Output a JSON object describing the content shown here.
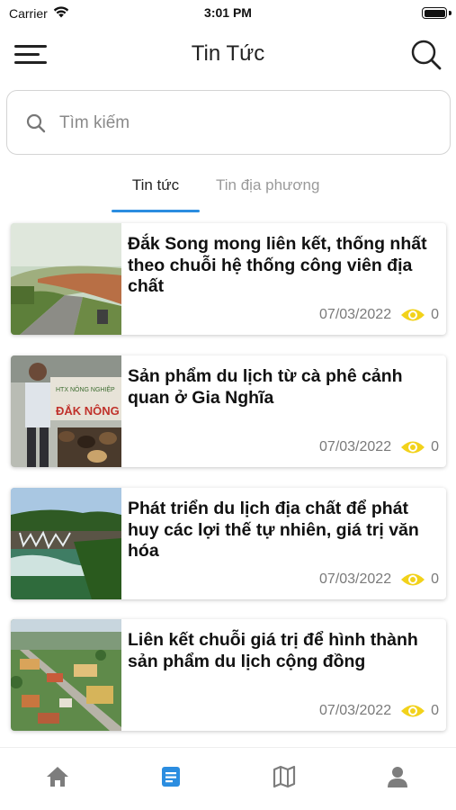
{
  "status_bar": {
    "carrier": "Carrier",
    "time": "3:01 PM",
    "icons": [
      "wifi-icon",
      "battery-icon"
    ]
  },
  "header": {
    "title": "Tin Tức",
    "icons": [
      "menu-icon",
      "search-icon"
    ]
  },
  "search": {
    "placeholder": "Tìm kiếm",
    "value": ""
  },
  "tabs": [
    {
      "label": "Tin tức",
      "active": true
    },
    {
      "label": "Tin địa phương",
      "active": false
    }
  ],
  "news": [
    {
      "title": "Đắk Song mong liên kết, thống nhất theo chuỗi hệ thống công viên địa chất",
      "date": "07/03/2022",
      "views": "0",
      "image": "road-landscape"
    },
    {
      "title": "Sản phẩm du lịch từ cà phê cảnh quan ở Gia Nghĩa",
      "date": "07/03/2022",
      "views": "0",
      "image": "coffee-producer"
    },
    {
      "title": "Phát triển du lịch địa chất để phát huy các lợi thế tự nhiên, giá trị văn hóa",
      "date": "07/03/2022",
      "views": "0",
      "image": "waterfall"
    },
    {
      "title": "Liên kết chuỗi giá trị để hình thành sản phẩm du lịch cộng đồng",
      "date": "07/03/2022",
      "views": "0",
      "image": "aerial-town"
    }
  ],
  "bottom_nav": [
    {
      "icon": "home-icon",
      "active": false
    },
    {
      "icon": "news-icon",
      "active": true
    },
    {
      "icon": "map-icon",
      "active": false
    },
    {
      "icon": "profile-icon",
      "active": false
    }
  ],
  "colors": {
    "accent": "#2b8de0",
    "eye": "#f2d21b",
    "nav_inactive": "#7d7d7d"
  }
}
